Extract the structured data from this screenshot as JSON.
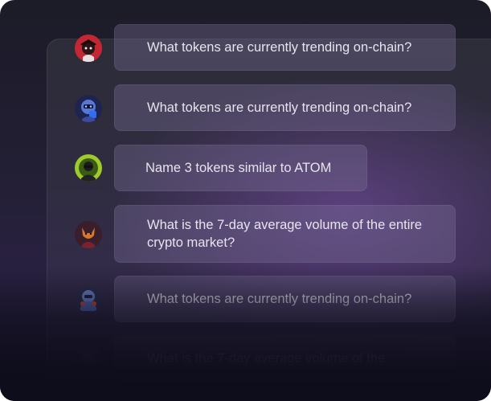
{
  "messages": [
    {
      "text": "What tokens are currently trending on-chain?",
      "avatar": "red-avatar-icon"
    },
    {
      "text": "What tokens are currently trending on-chain?",
      "avatar": "blue-robot-avatar-icon"
    },
    {
      "text": "Name 3 tokens similar to ATOM",
      "avatar": "green-avatar-icon"
    },
    {
      "text": "What is the 7-day average volume of the entire crypto market?",
      "avatar": "fox-avatar-icon"
    },
    {
      "text": "What tokens are currently trending on-chain?",
      "avatar": "blue-armor-avatar-icon"
    },
    {
      "text": "What is the 7-day average volume of the",
      "avatar": "faded-avatar-icon"
    }
  ],
  "colors": {
    "background": "#1c1b27",
    "accent_glow": "#7846aa",
    "bubble": "#6e6690",
    "text": "#e7e4ef"
  }
}
